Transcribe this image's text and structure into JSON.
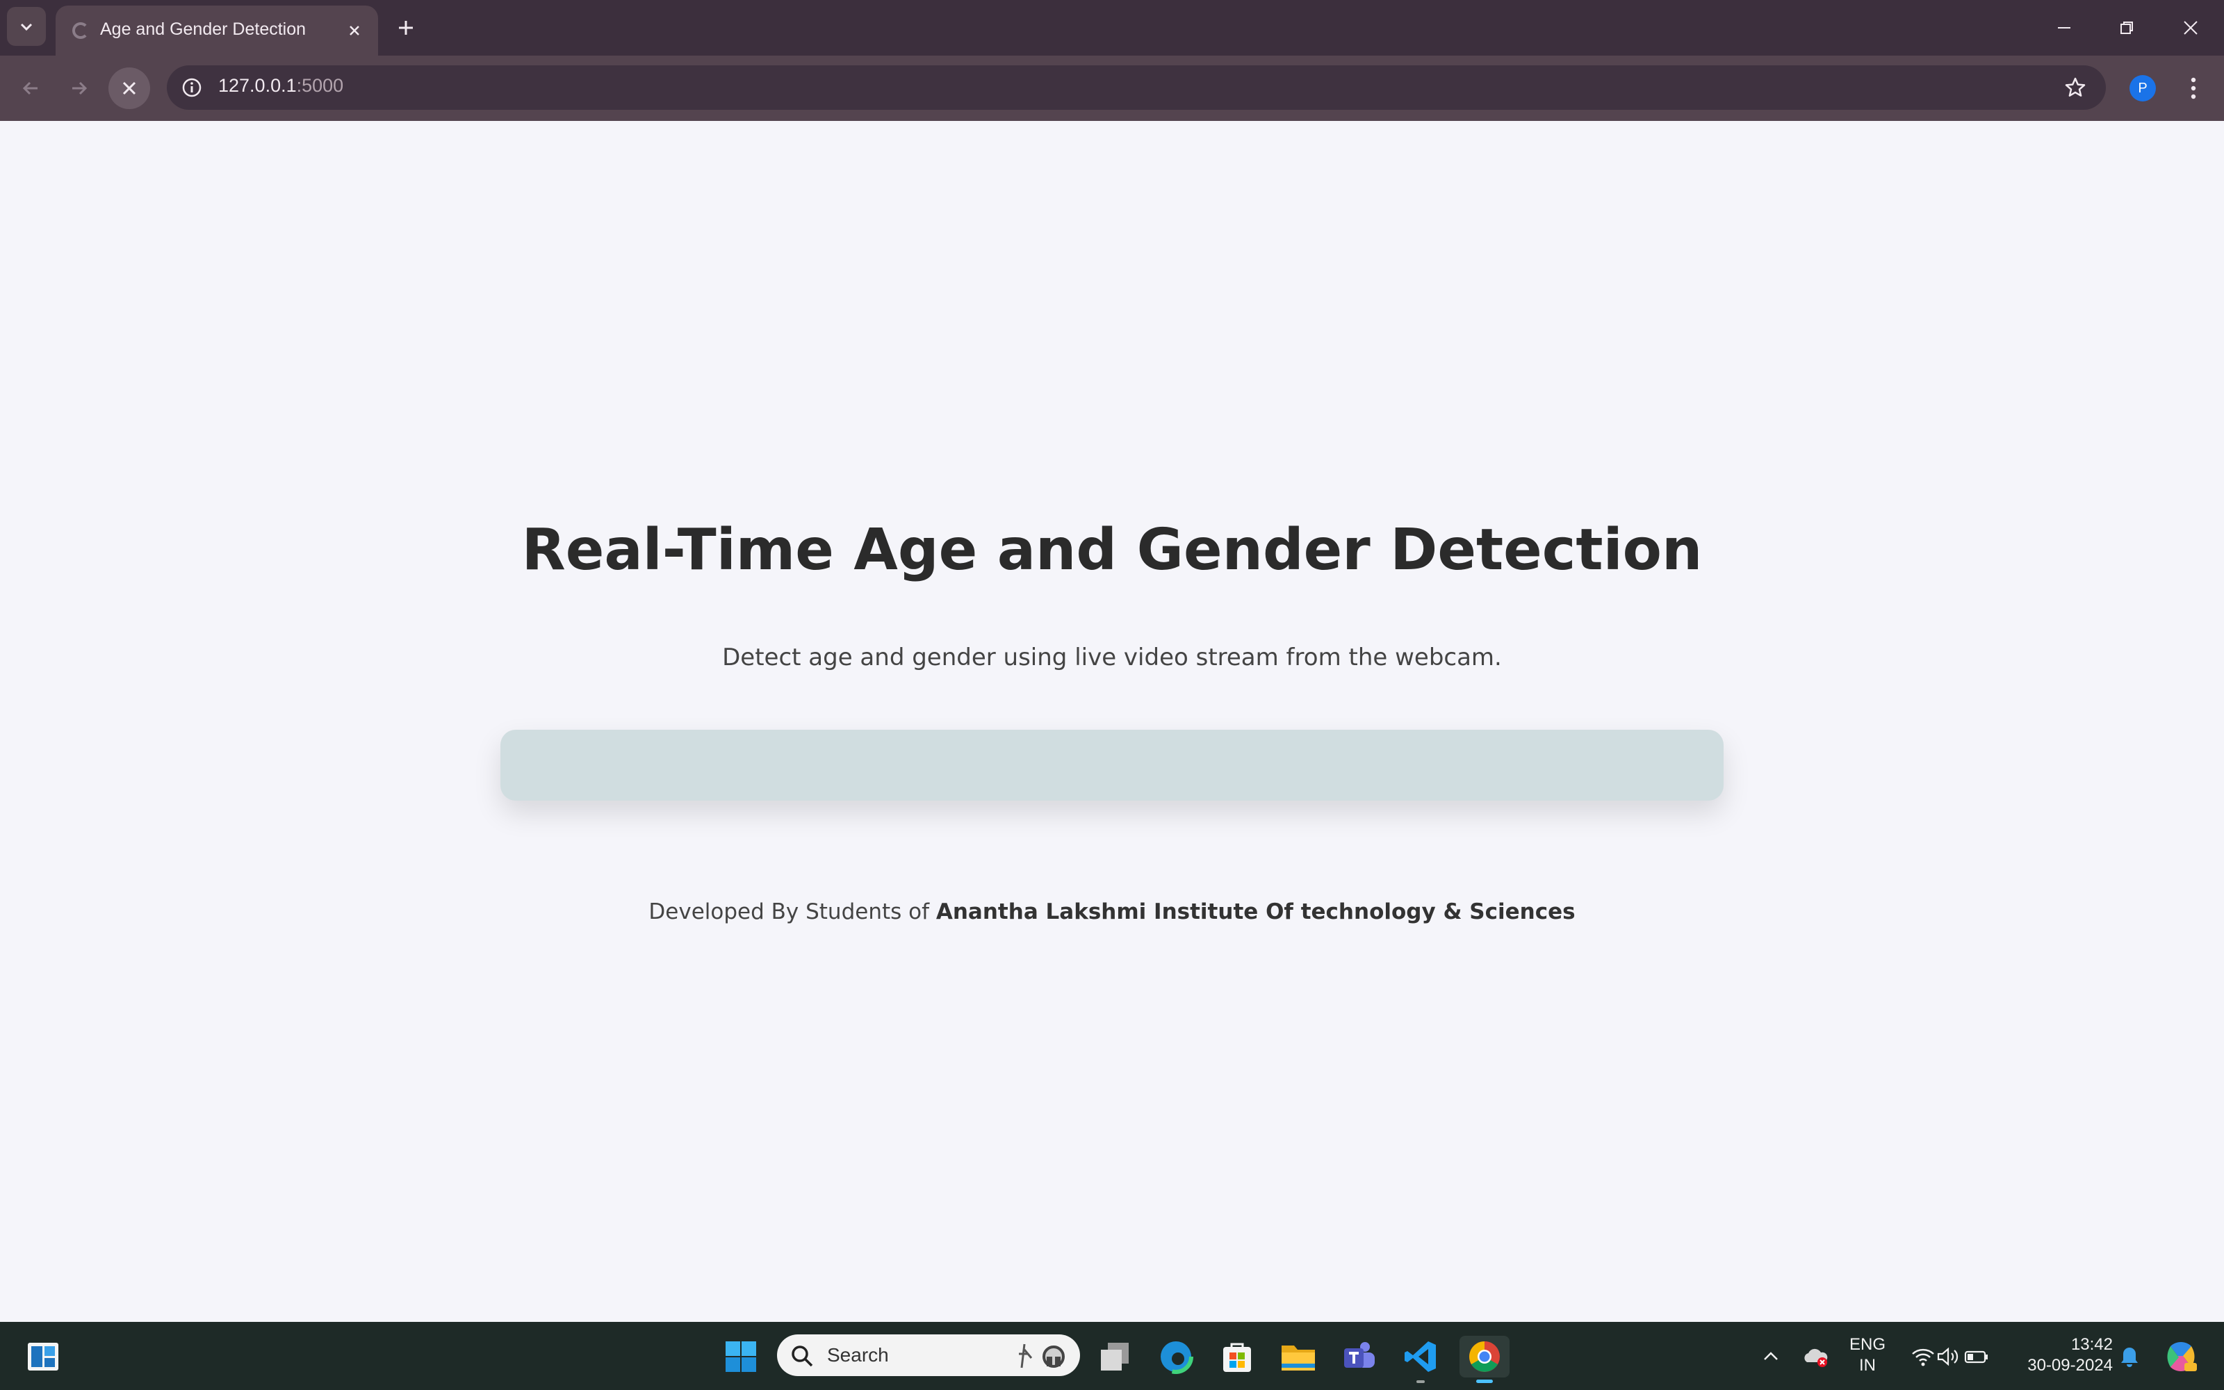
{
  "browser": {
    "tab_title": "Age and Gender Detection",
    "url_host": "127.0.0.1",
    "url_port": ":5000",
    "profile_initial": "P"
  },
  "page": {
    "heading": "Real-Time Age and Gender Detection",
    "subtitle": "Detect age and gender using live video stream from the webcam.",
    "footer_prefix": "Developed By Students of ",
    "footer_institute": "Anantha Lakshmi Institute Of technology & Sciences"
  },
  "taskbar": {
    "search_placeholder": "Search",
    "language_line1": "ENG",
    "language_line2": "IN",
    "time": "13:42",
    "date": "30-09-2024"
  },
  "icons": [
    "chevron-down-icon",
    "close-icon",
    "plus-icon",
    "minimize-icon",
    "restore-icon",
    "back-arrow-icon",
    "forward-arrow-icon",
    "stop-icon",
    "info-icon",
    "star-icon",
    "kebab-menu-icon",
    "widgets-icon",
    "windows-start-icon",
    "search-icon",
    "task-view-icon",
    "edge-icon",
    "store-icon",
    "file-explorer-icon",
    "teams-icon",
    "vscode-icon",
    "chrome-icon",
    "chevron-up-icon",
    "onedrive-icon",
    "wifi-icon",
    "volume-icon",
    "battery-icon",
    "bell-icon",
    "copilot-icon"
  ],
  "colors": {
    "tab_strip": "#3c2f3d",
    "toolbar": "#54444f",
    "page_background": "#f5f5fa",
    "video_box": "#d0dde0",
    "taskbar": "#1e2a27"
  }
}
